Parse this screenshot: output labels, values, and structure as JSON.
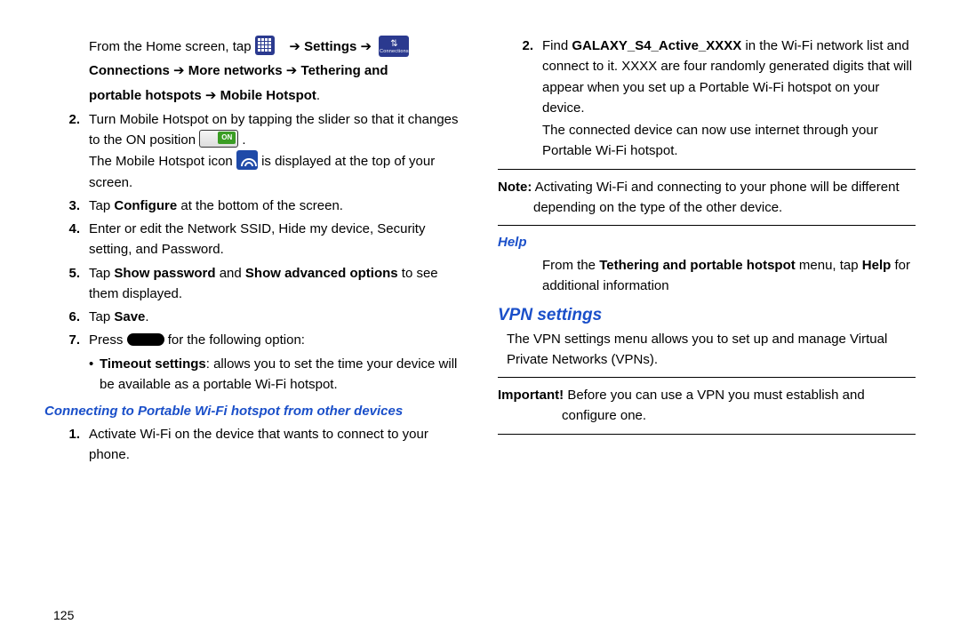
{
  "col1": {
    "intro_pre": "From the Home screen, tap ",
    "settings": "Settings",
    "nav_line1_a": "Connections",
    "nav_line1_b": "More networks",
    "nav_line1_c": "Tethering and",
    "nav_line2_a": "portable hotspots",
    "nav_line2_b": "Mobile Hotspot",
    "step2_num": "2.",
    "step2a": "Turn Mobile Hotspot on by tapping the slider so that it changes to the ON position ",
    "step2b": ".",
    "step2c_a": "The Mobile Hotspot icon ",
    "step2c_b": " is displayed at the top of your screen.",
    "step3_num": "3.",
    "step3_a": "Tap ",
    "step3_b": "Configure",
    "step3_c": " at the bottom of the screen.",
    "step4_num": "4.",
    "step4": "Enter or edit the Network SSID, Hide my device, Security setting, and Password.",
    "step5_num": "5.",
    "step5_a": "Tap ",
    "step5_b": "Show password",
    "step5_c": " and ",
    "step5_d": "Show advanced options",
    "step5_e": " to see them displayed.",
    "step6_num": "6.",
    "step6_a": "Tap ",
    "step6_b": "Save",
    "step6_c": ".",
    "step7_num": "7.",
    "step7_a": "Press ",
    "step7_b": " for the following option:",
    "step7_bullet_a": "Timeout settings",
    "step7_bullet_b": ": allows you to set the time your device will be available as a portable Wi-Fi hotspot.",
    "head2": "Connecting to Portable Wi-Fi hotspot from other devices",
    "c_step1_num": "1.",
    "c_step1": "Activate Wi-Fi on the device that wants to connect to your phone."
  },
  "col2": {
    "step2_num": "2.",
    "step2_a": "Find ",
    "step2_b": "GALAXY_S4_Active_XXXX",
    "step2_c": " in the Wi-Fi network list and connect to it. XXXX are four randomly generated digits that will appear when you set up a Portable Wi-Fi hotspot on your device.",
    "step2_d": "The connected device can now use internet through your Portable Wi-Fi hotspot.",
    "note_lbl": "Note:",
    "note_body": " Activating Wi-Fi and connecting to your phone will be different depending on the type of the other device.",
    "help_head": "Help",
    "help_a": "From the ",
    "help_b": "Tethering and portable hotspot",
    "help_c": " menu, tap ",
    "help_d": "Help",
    "help_e": " for additional information",
    "vpn_head": "VPN settings",
    "vpn_body": "The VPN settings menu allows you to set up and manage Virtual Private Networks (VPNs).",
    "imp_lbl": "Important!",
    "imp_body": " Before you can use a VPN you must establish and configure one."
  },
  "pagenum": "125"
}
